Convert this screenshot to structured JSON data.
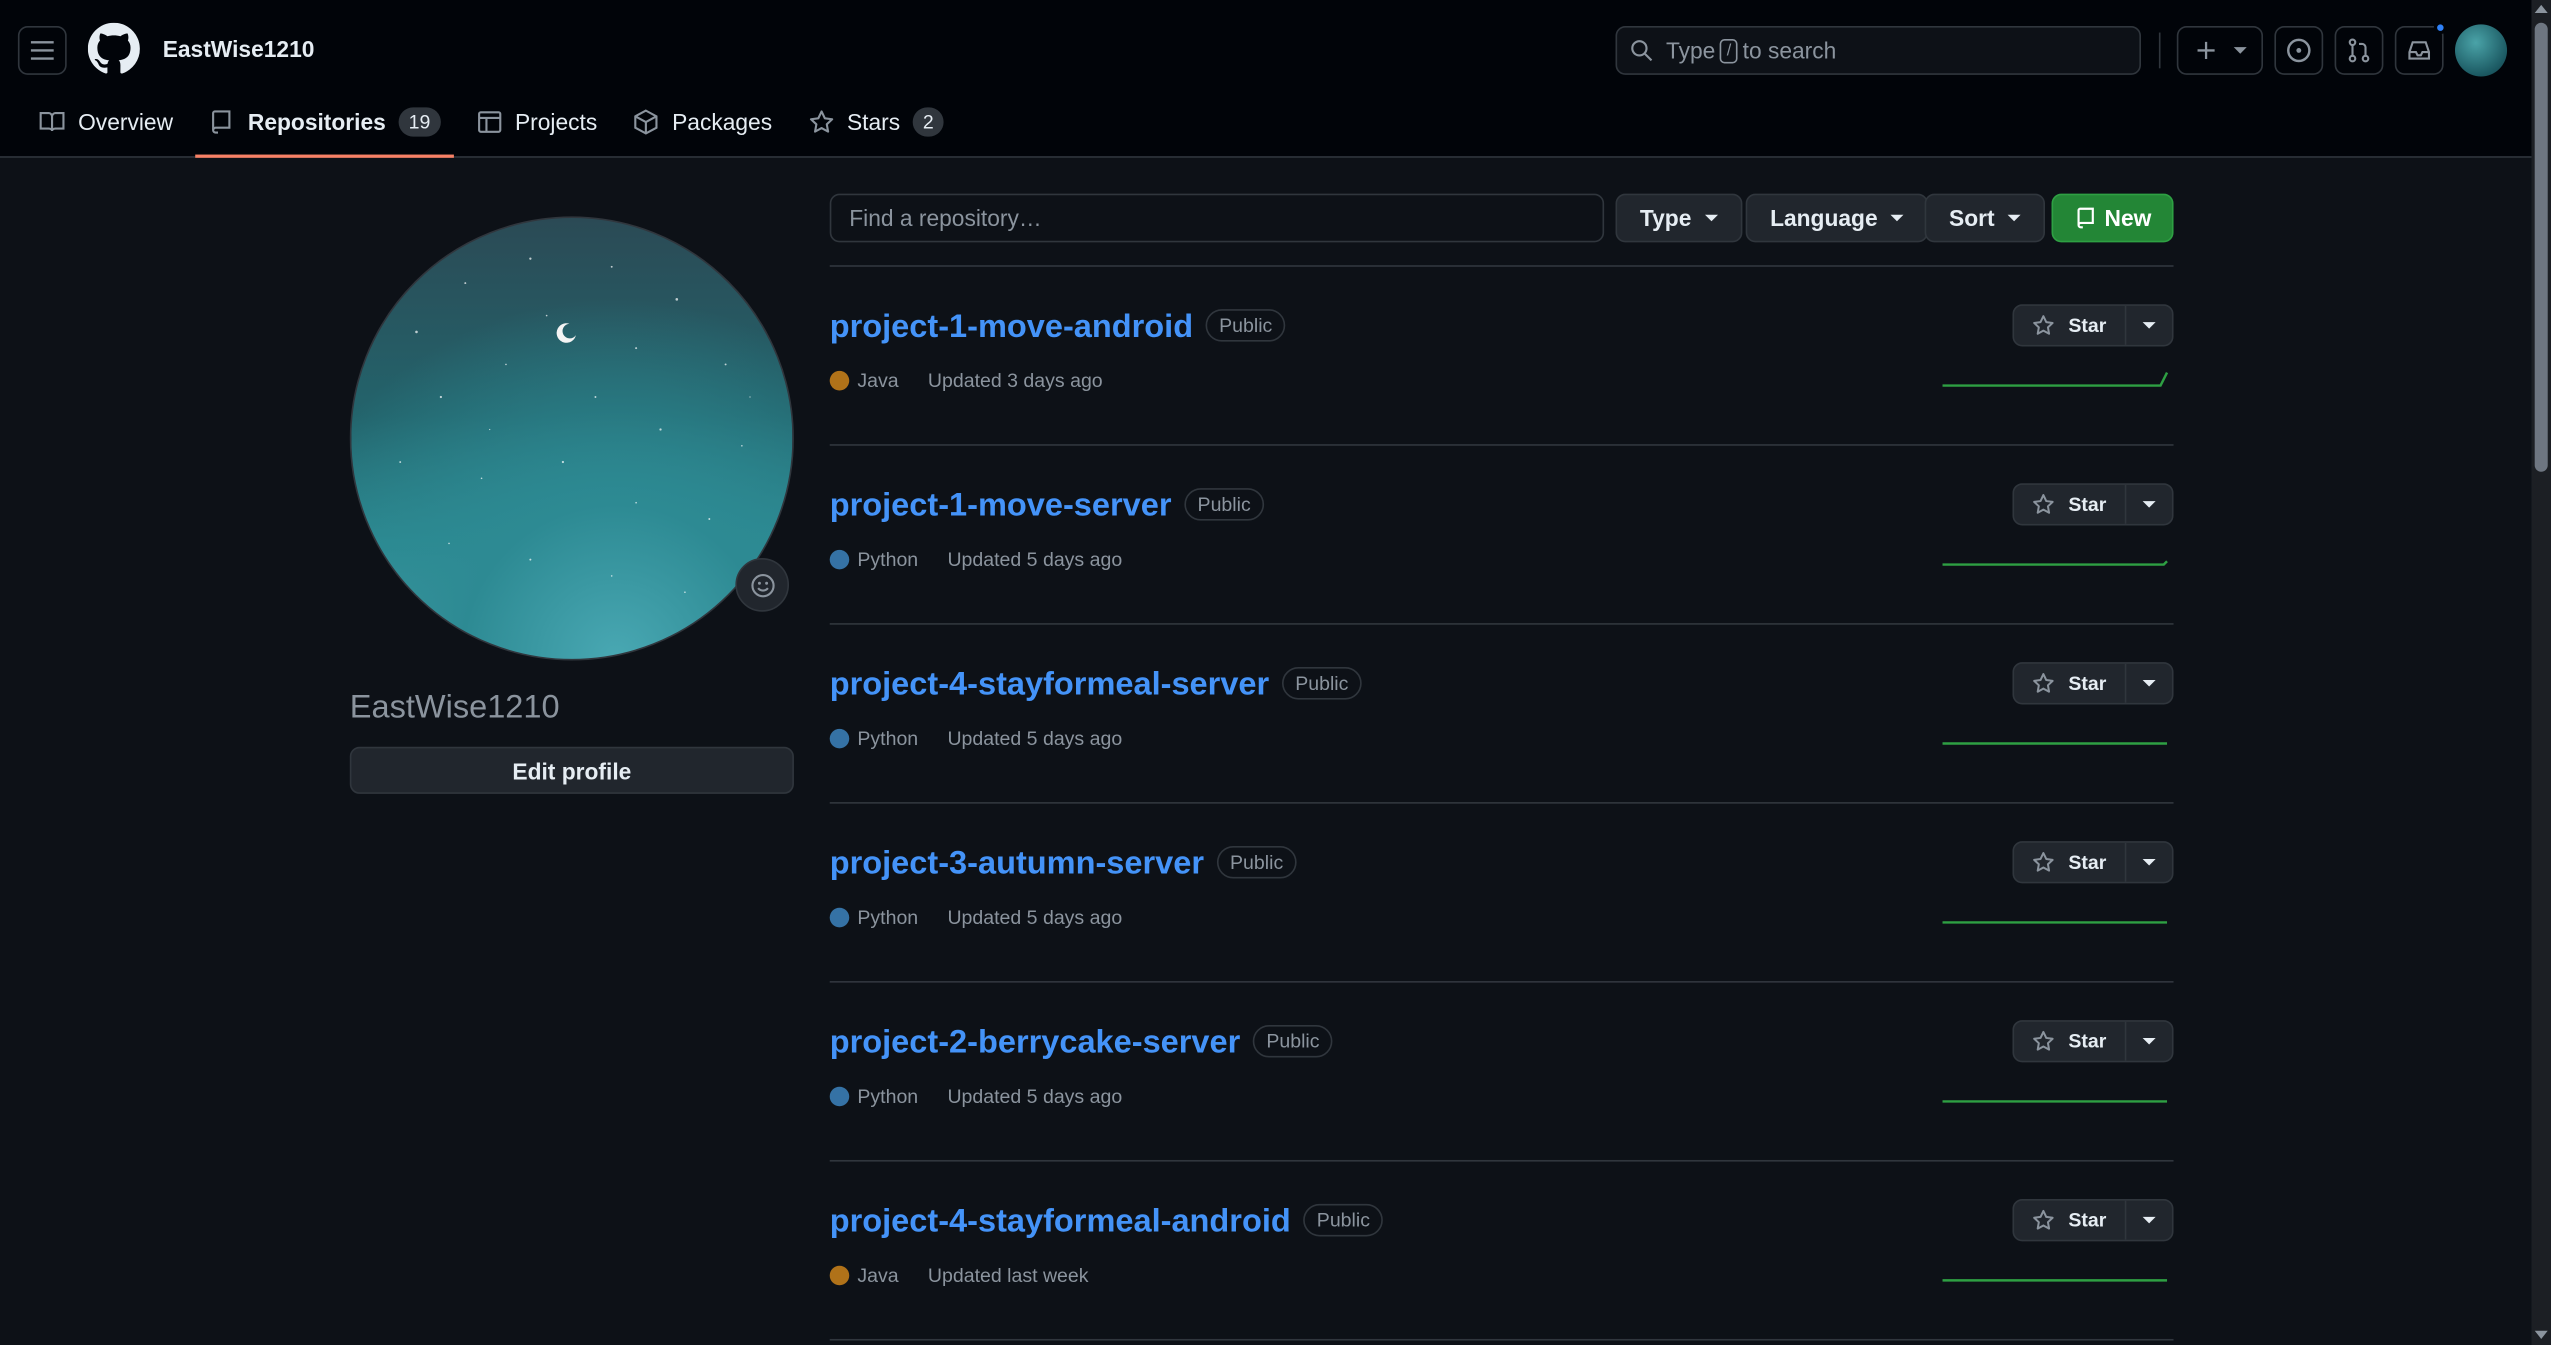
{
  "header": {
    "username": "EastWise1210",
    "search_prefix": "Type",
    "search_key": "/",
    "search_suffix": "to search"
  },
  "tabs": [
    {
      "label": "Overview"
    },
    {
      "label": "Repositories",
      "count": "19"
    },
    {
      "label": "Projects"
    },
    {
      "label": "Packages"
    },
    {
      "label": "Stars",
      "count": "2"
    }
  ],
  "profile": {
    "name": "EastWise1210",
    "edit_label": "Edit profile"
  },
  "toolbar": {
    "find_placeholder": "Find a repository…",
    "type_label": "Type",
    "language_label": "Language",
    "sort_label": "Sort",
    "new_label": "New"
  },
  "repos": [
    {
      "name": "project-1-move-android",
      "visibility": "Public",
      "language": "Java",
      "lang_color": "#b07219",
      "updated": "Updated 3 days ago",
      "star_label": "Star"
    },
    {
      "name": "project-1-move-server",
      "visibility": "Public",
      "language": "Python",
      "lang_color": "#3572A5",
      "updated": "Updated 5 days ago",
      "star_label": "Star"
    },
    {
      "name": "project-4-stayformeal-server",
      "visibility": "Public",
      "language": "Python",
      "lang_color": "#3572A5",
      "updated": "Updated 5 days ago",
      "star_label": "Star"
    },
    {
      "name": "project-3-autumn-server",
      "visibility": "Public",
      "language": "Python",
      "lang_color": "#3572A5",
      "updated": "Updated 5 days ago",
      "star_label": "Star"
    },
    {
      "name": "project-2-berrycake-server",
      "visibility": "Public",
      "language": "Python",
      "lang_color": "#3572A5",
      "updated": "Updated 5 days ago",
      "star_label": "Star"
    },
    {
      "name": "project-4-stayformeal-android",
      "visibility": "Public",
      "language": "Java",
      "lang_color": "#b07219",
      "updated": "Updated last week",
      "star_label": "Star"
    }
  ],
  "colors": {
    "accent_link": "#4493f8",
    "new_button": "#238636",
    "tab_underline": "#f78166",
    "sparkline": "#2ea043"
  }
}
